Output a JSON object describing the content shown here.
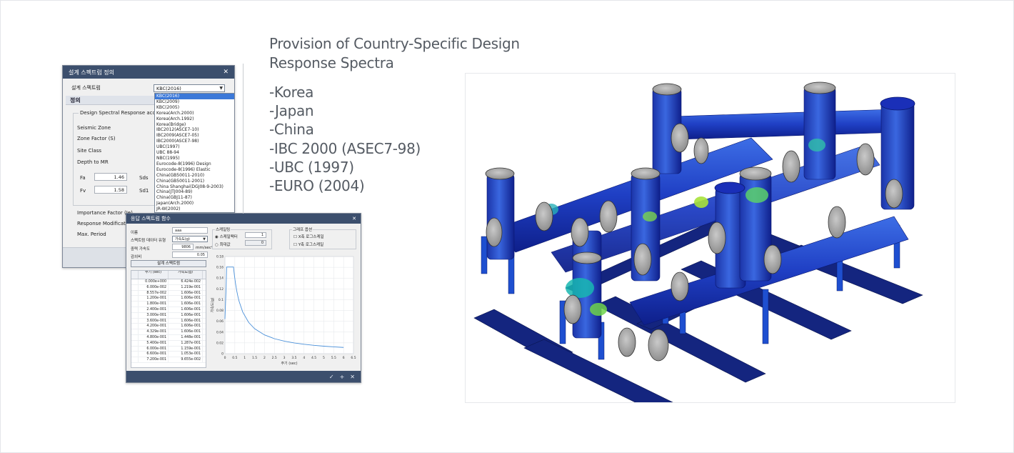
{
  "heading": {
    "line1": "Provision of Country-Specific Design",
    "line2": "Response Spectra"
  },
  "countries": [
    "-Korea",
    "-Japan",
    "-China",
    "-IBC 2000 (ASEC7-98)",
    "-UBC (1997)",
    "-EURO (2004)"
  ],
  "dialog_spectrum": {
    "title": "설계 스펙트럼 정의",
    "spectrum_label": "설계 스펙트럼",
    "selected": "KBC(2016)",
    "section_title": "정의",
    "group_title": "Design Spectral Response acce",
    "seismic_zone": "Seismic Zone",
    "zone_factor": "Zone Factor (S)",
    "site_class": "Site Class",
    "depth_to_mr": "Depth to MR",
    "fa_label": "Fa",
    "fa_value": "1.46",
    "sds_label": "Sds",
    "fv_label": "Fv",
    "fv_value": "1.58",
    "sd1_label": "Sd1",
    "importance_factor": "Importance Factor (Ie)",
    "response_mod": "Response Modification",
    "max_period": "Max. Period",
    "options": [
      "KBC(2016)",
      "KBC(2009)",
      "KBC(2005)",
      "Korea(Arch.2000)",
      "Korea(Arch.1992)",
      "Korea(Bridge)",
      "IBC2012(ASCE7-10)",
      "IBC2009(ASCE7-05)",
      "IBC2000(ASCE7-98)",
      "UBC(1997)",
      "UBC 88-94",
      "NBC(1995)",
      "Eurocode-8(1996) Design",
      "Eurocode-8(1996) Elastic",
      "China(GB50011-2010)",
      "China(GB50011-2001)",
      "China Shanghai(DGJ08-9-2003)",
      "China(JTJ004-89)",
      "China(GBJ11-87)",
      "Japan(Arch.2000)",
      "JR-W(2002)"
    ]
  },
  "dialog_function": {
    "title": "응답 스펙트럼 함수",
    "name_label": "이름",
    "name_value": "aaa",
    "data_type_label": "스펙트럼 데이터 유형",
    "data_type_value": "가속도(g)",
    "gravity_label": "중력 가속도",
    "gravity_value": "9806",
    "gravity_unit": "mm/sec²",
    "damping_label": "감쇠비",
    "damping_value": "0.05",
    "design_button": "설계 스펙트럼",
    "scale_group": "스케일링",
    "scale_factor": "스케일팩터",
    "scale_factor_value": "1",
    "max_value": "최대값",
    "max_value_value": "0",
    "graph_group": "그래프 옵션",
    "x_log": "X축 로그스케일",
    "y_log": "Y축 로그스케일",
    "col_period": "주기 (sec)",
    "col_accel": "가속도(g)",
    "rows": [
      [
        "0.000e+000",
        "6.424e-002"
      ],
      [
        "6.000e-002",
        "1.219e-001"
      ],
      [
        "8.557e-002",
        "1.606e-001"
      ],
      [
        "1.200e-001",
        "1.606e-001"
      ],
      [
        "1.800e-001",
        "1.606e-001"
      ],
      [
        "2.400e-001",
        "1.606e-001"
      ],
      [
        "3.000e-001",
        "1.606e-001"
      ],
      [
        "3.600e-001",
        "1.606e-001"
      ],
      [
        "4.200e-001",
        "1.606e-001"
      ],
      [
        "4.329e-001",
        "1.606e-001"
      ],
      [
        "4.800e-001",
        "1.448e-001"
      ],
      [
        "5.400e-001",
        "1.287e-001"
      ],
      [
        "6.000e-001",
        "1.159e-001"
      ],
      [
        "6.600e-001",
        "1.053e-001"
      ],
      [
        "7.200e-001",
        "9.655e-002"
      ]
    ],
    "chart_data": {
      "type": "line",
      "xlabel": "주기 (sec)",
      "ylabel": "가속도(g)",
      "xlim": [
        0,
        6.5
      ],
      "ylim": [
        0,
        0.18
      ],
      "x_ticks": [
        "0",
        "0.5",
        "1",
        "1.5",
        "2",
        "2.5",
        "3",
        "3.5",
        "4",
        "4.5",
        "5",
        "5.5",
        "6",
        "6.5"
      ],
      "y_ticks": [
        "0",
        "0.02",
        "0.04",
        "0.06",
        "0.08",
        "0.1",
        "0.12",
        "0.14",
        "0.16",
        "0.18"
      ],
      "grid": true,
      "series": [
        {
          "x": [
            0,
            0.06,
            0.0856,
            0.12,
            0.18,
            0.24,
            0.3,
            0.36,
            0.42,
            0.4329,
            0.48,
            0.54,
            0.6,
            0.66,
            0.72,
            0.9,
            1.2,
            1.5,
            2.0,
            2.5,
            3.0,
            3.5,
            4.0,
            4.5,
            5.0,
            5.5,
            6.0
          ],
          "y": [
            0.0642,
            0.1219,
            0.1606,
            0.1606,
            0.1606,
            0.1606,
            0.1606,
            0.1606,
            0.1606,
            0.1606,
            0.1448,
            0.1287,
            0.1159,
            0.1053,
            0.0966,
            0.0772,
            0.0579,
            0.0463,
            0.0348,
            0.0278,
            0.0232,
            0.0199,
            0.0174,
            0.0154,
            0.0139,
            0.0126,
            0.0116
          ]
        }
      ]
    }
  },
  "colors": {
    "text": "#555b63",
    "titlebar": "#3c4f6d",
    "selection": "#3b78d8",
    "curve": "#4a90d9"
  }
}
